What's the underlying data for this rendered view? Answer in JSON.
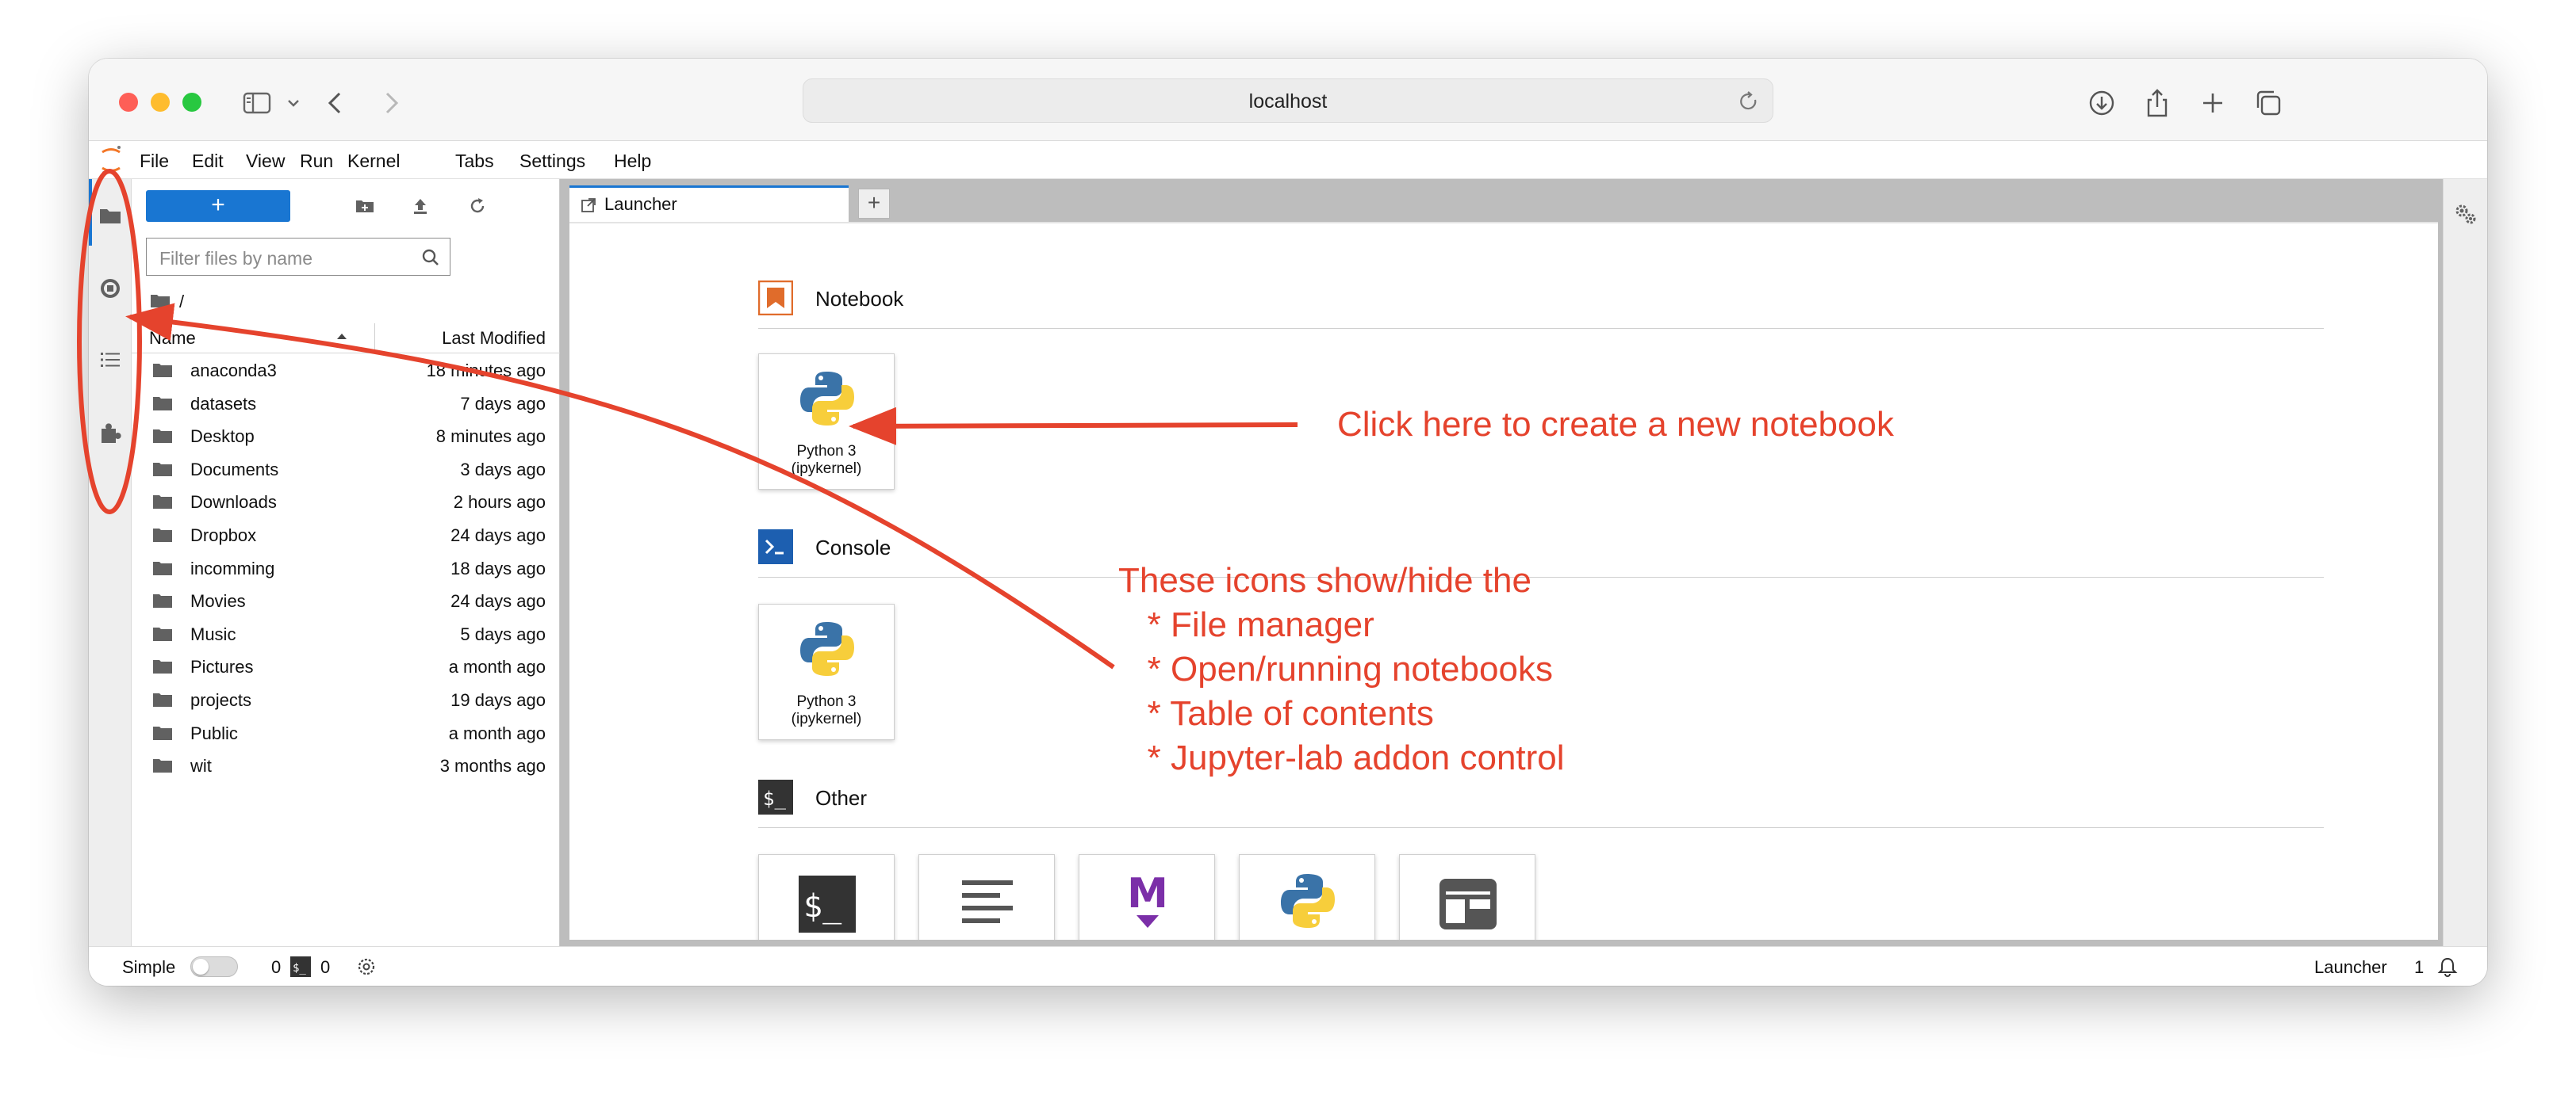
{
  "browser": {
    "url": "localhost"
  },
  "menu": {
    "items": [
      "File",
      "Edit",
      "View",
      "Run",
      "Kernel",
      "Tabs",
      "Settings",
      "Help"
    ]
  },
  "file_browser": {
    "new_button_label": "+",
    "filter_placeholder": "Filter files by name",
    "breadcrumb": "/",
    "columns": {
      "name": "Name",
      "modified": "Last Modified"
    },
    "rows": [
      {
        "name": "anaconda3",
        "modified": "18 minutes ago"
      },
      {
        "name": "datasets",
        "modified": "7 days ago"
      },
      {
        "name": "Desktop",
        "modified": "8 minutes ago"
      },
      {
        "name": "Documents",
        "modified": "3 days ago"
      },
      {
        "name": "Downloads",
        "modified": "2 hours ago"
      },
      {
        "name": "Dropbox",
        "modified": "24 days ago"
      },
      {
        "name": "incomming",
        "modified": "18 days ago"
      },
      {
        "name": "Movies",
        "modified": "24 days ago"
      },
      {
        "name": "Music",
        "modified": "5 days ago"
      },
      {
        "name": "Pictures",
        "modified": "a month ago"
      },
      {
        "name": "projects",
        "modified": "19 days ago"
      },
      {
        "name": "Public",
        "modified": "a month ago"
      },
      {
        "name": "wit",
        "modified": "3 months ago"
      }
    ]
  },
  "tabs": {
    "launcher_label": "Launcher",
    "add_label": "+"
  },
  "launcher": {
    "notebook_section": "Notebook",
    "console_section": "Console",
    "other_section": "Other",
    "notebook_card": {
      "line1": "Python 3",
      "line2": "(ipykernel)"
    },
    "console_card": {
      "line1": "Python 3",
      "line2": "(ipykernel)"
    },
    "other_cards": [
      "terminal-icon",
      "text-file-icon",
      "markdown-icon",
      "python-file-icon",
      "contextual-help-icon"
    ]
  },
  "statusbar": {
    "mode_label": "Simple",
    "kernels_count": "0",
    "terminals_count": "0",
    "launcher_label": "Launcher",
    "notification_count": "1"
  },
  "annotations": {
    "click_hint": "Click here to create a new notebook",
    "icons_hint": "These icons show/hide the\n   * File manager\n   * Open/running notebooks\n   * Table of contents\n   * Jupyter-lab addon control",
    "color": "#e5432d"
  }
}
